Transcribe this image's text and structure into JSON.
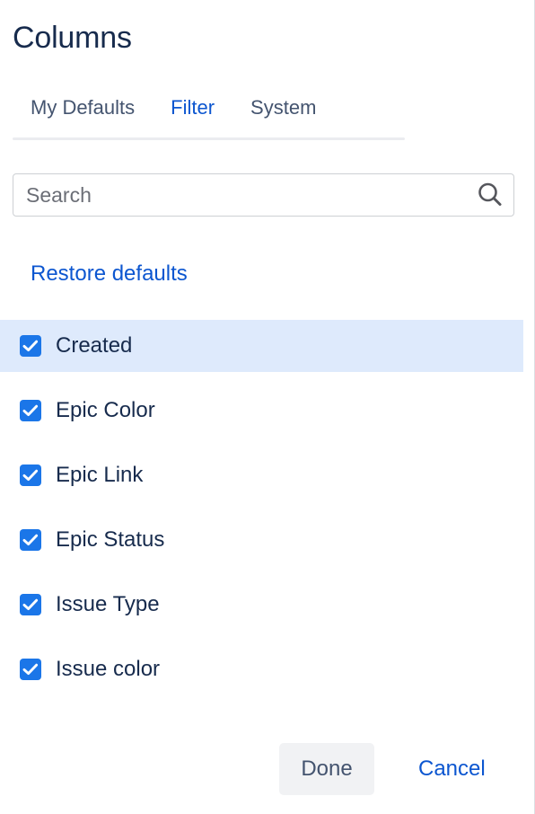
{
  "dialog": {
    "title": "Columns"
  },
  "tabs": {
    "items": [
      {
        "label": "My Defaults",
        "active": false
      },
      {
        "label": "Filter",
        "active": true
      },
      {
        "label": "System",
        "active": false
      }
    ]
  },
  "search": {
    "placeholder": "Search",
    "value": "",
    "icon": "search-icon"
  },
  "actions": {
    "restore_defaults_label": "Restore defaults"
  },
  "columns": {
    "items": [
      {
        "label": "Created",
        "checked": true,
        "highlighted": true
      },
      {
        "label": "Epic Color",
        "checked": true,
        "highlighted": false
      },
      {
        "label": "Epic Link",
        "checked": true,
        "highlighted": false
      },
      {
        "label": "Epic Status",
        "checked": true,
        "highlighted": false
      },
      {
        "label": "Issue Type",
        "checked": true,
        "highlighted": false
      },
      {
        "label": "Issue color",
        "checked": true,
        "highlighted": false
      }
    ]
  },
  "footer": {
    "done_label": "Done",
    "cancel_label": "Cancel"
  },
  "colors": {
    "accent_blue": "#0c56d0",
    "checkbox_blue": "#1b76e8",
    "row_highlight": "#deeafc",
    "title_navy": "#172b4d",
    "tab_inactive": "#44546f",
    "done_button_bg": "#f1f2f4"
  }
}
